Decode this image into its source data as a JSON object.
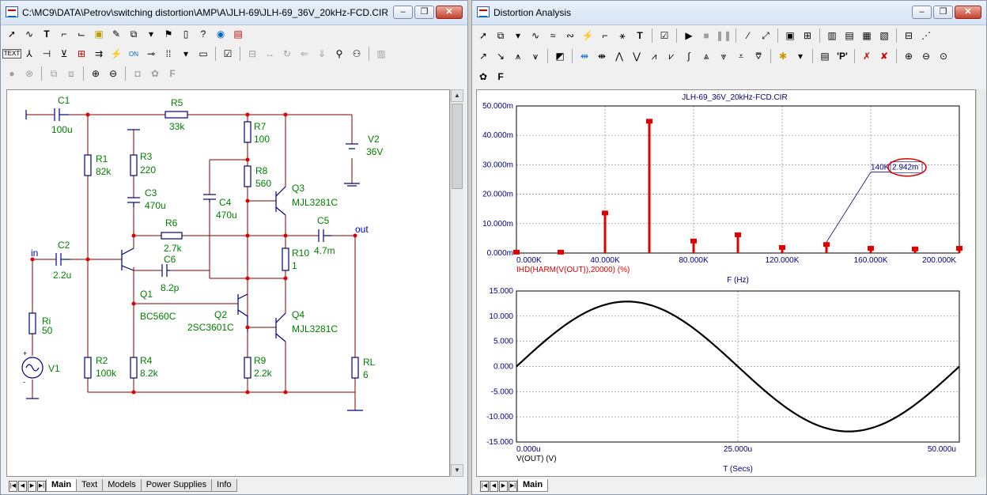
{
  "schematic_window": {
    "title": "C:\\MC9\\DATA\\Petrov\\switching distortion\\AMP\\A\\JLH-69\\JLH-69_36V_20kHz-FCD.CIR",
    "tabs": [
      "Main",
      "Text",
      "Models",
      "Power Supplies",
      "Info"
    ],
    "active_tab": "Main",
    "components": {
      "C1": {
        "ref": "C1",
        "value": "100u"
      },
      "R5": {
        "ref": "R5",
        "value": "33k"
      },
      "V2": {
        "ref": "V2",
        "value": "36V"
      },
      "R7": {
        "ref": "R7",
        "value": "100"
      },
      "R1": {
        "ref": "R1",
        "value": "82k"
      },
      "R3": {
        "ref": "R3",
        "value": "220"
      },
      "R8": {
        "ref": "R8",
        "value": "560"
      },
      "Q3": {
        "ref": "Q3",
        "value": "MJL3281C"
      },
      "C3": {
        "ref": "C3",
        "value": "470u"
      },
      "C4": {
        "ref": "C4",
        "value": "470u"
      },
      "R6": {
        "ref": "R6",
        "value": "2.7k"
      },
      "C5": {
        "ref": "C5",
        "value": "4.7m"
      },
      "C2": {
        "ref": "C2",
        "value": "2.2u"
      },
      "C6": {
        "ref": "C6",
        "value": "8.2p"
      },
      "R10": {
        "ref": "R10",
        "value": "1"
      },
      "Q1": {
        "ref": "Q1",
        "value": "BC560C"
      },
      "Q2": {
        "ref": "Q2",
        "value": "2SC3601C"
      },
      "Q4": {
        "ref": "Q4",
        "value": "MJL3281C"
      },
      "Ri": {
        "ref": "Ri",
        "value": "50"
      },
      "V1": {
        "ref": "V1"
      },
      "R2": {
        "ref": "R2",
        "value": "100k"
      },
      "R4": {
        "ref": "R4",
        "value": "8.2k"
      },
      "R9": {
        "ref": "R9",
        "value": "2.2k"
      },
      "RL": {
        "ref": "RL",
        "value": "6"
      }
    },
    "net_labels": {
      "in": "in",
      "out": "out"
    },
    "wire_color": "#800000",
    "label_color": "#008000"
  },
  "analysis_window": {
    "title": "Distortion Analysis",
    "tabs": [
      "Main"
    ],
    "active_tab": "Main",
    "cursor_label": "140K",
    "cursor_value": "2.942m"
  },
  "chart_data": [
    {
      "type": "bar",
      "title": "JLH-69_36V_20kHz-FCD.CIR",
      "xlabel": "F (Hz)",
      "ylabel": "IHD(HARM(V(OUT)),20000) (%)",
      "xlim": [
        0,
        200000
      ],
      "ylim": [
        0,
        0.05
      ],
      "x_ticks": [
        "0.000K",
        "40.000K",
        "80.000K",
        "120.000K",
        "160.000K",
        "200.000K"
      ],
      "y_ticks": [
        "0.000m",
        "10.000m",
        "20.000m",
        "30.000m",
        "40.000m",
        "50.000m"
      ],
      "x": [
        0,
        20000,
        40000,
        60000,
        80000,
        100000,
        120000,
        140000,
        160000,
        180000,
        200000
      ],
      "values": [
        0.0003,
        0.0003,
        0.0136,
        0.0448,
        0.0041,
        0.0062,
        0.0019,
        0.0029,
        0.0016,
        0.0014,
        0.0016
      ],
      "color": "#e00000",
      "grid": true
    },
    {
      "type": "line",
      "xlabel": "T (Secs)",
      "ylabel": "V(OUT) (V)",
      "xlim": [
        0,
        5e-05
      ],
      "ylim": [
        -15,
        15
      ],
      "x_ticks": [
        "0.000u",
        "25.000u",
        "50.000u"
      ],
      "y_ticks": [
        "15.000",
        "10.000",
        "5.000",
        "0.000",
        "-5.000",
        "-10.000",
        "-15.000"
      ],
      "amplitude": 12.9,
      "period": 5e-05,
      "color": "#000000",
      "grid": true
    }
  ]
}
